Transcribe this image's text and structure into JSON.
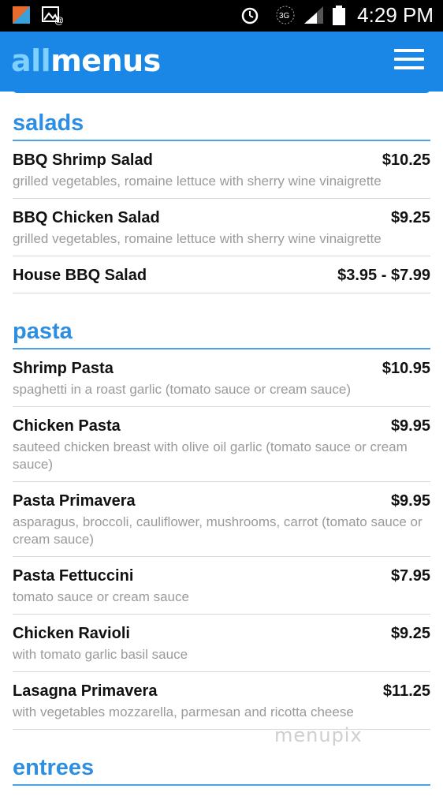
{
  "status_bar": {
    "time": "4:29 PM",
    "network": "3G",
    "icons": [
      "app-icon",
      "image-icon",
      "alarm-icon",
      "signal-icon",
      "battery-icon"
    ]
  },
  "app_bar": {
    "logo_prefix": "all",
    "logo_suffix": "menus",
    "menu_icon": "hamburger-icon",
    "color": "#1a87e6"
  },
  "sections": [
    {
      "title": "salads",
      "items": [
        {
          "name": "BBQ Shrimp Salad",
          "price": "$10.25",
          "desc": "grilled vegetables, romaine lettuce with sherry wine vinaigrette"
        },
        {
          "name": "BBQ Chicken Salad",
          "price": "$9.25",
          "desc": "grilled vegetables, romaine lettuce with sherry wine vinaigrette"
        },
        {
          "name": "House BBQ Salad",
          "price": "$3.95 - $7.99",
          "desc": ""
        }
      ]
    },
    {
      "title": "pasta",
      "items": [
        {
          "name": "Shrimp Pasta",
          "price": "$10.95",
          "desc": "spaghetti in a roast garlic (tomato sauce or cream sauce)"
        },
        {
          "name": "Chicken Pasta",
          "price": "$9.95",
          "desc": "sauteed chicken breast with olive oil garlic (tomato sauce or cream sauce)"
        },
        {
          "name": "Pasta Primavera",
          "price": "$9.95",
          "desc": "asparagus, broccoli, cauliflower, mushrooms, carrot (tomato sauce or cream sauce)"
        },
        {
          "name": "Pasta Fettuccini",
          "price": "$7.95",
          "desc": "tomato sauce or cream sauce"
        },
        {
          "name": "Chicken Ravioli",
          "price": "$9.25",
          "desc": "with tomato garlic basil sauce"
        },
        {
          "name": "Lasagna Primavera",
          "price": "$11.25",
          "desc": "with vegetables mozzarella, parmesan and ricotta cheese"
        }
      ]
    },
    {
      "title": "entrees",
      "items": []
    }
  ],
  "watermark": "menupix"
}
